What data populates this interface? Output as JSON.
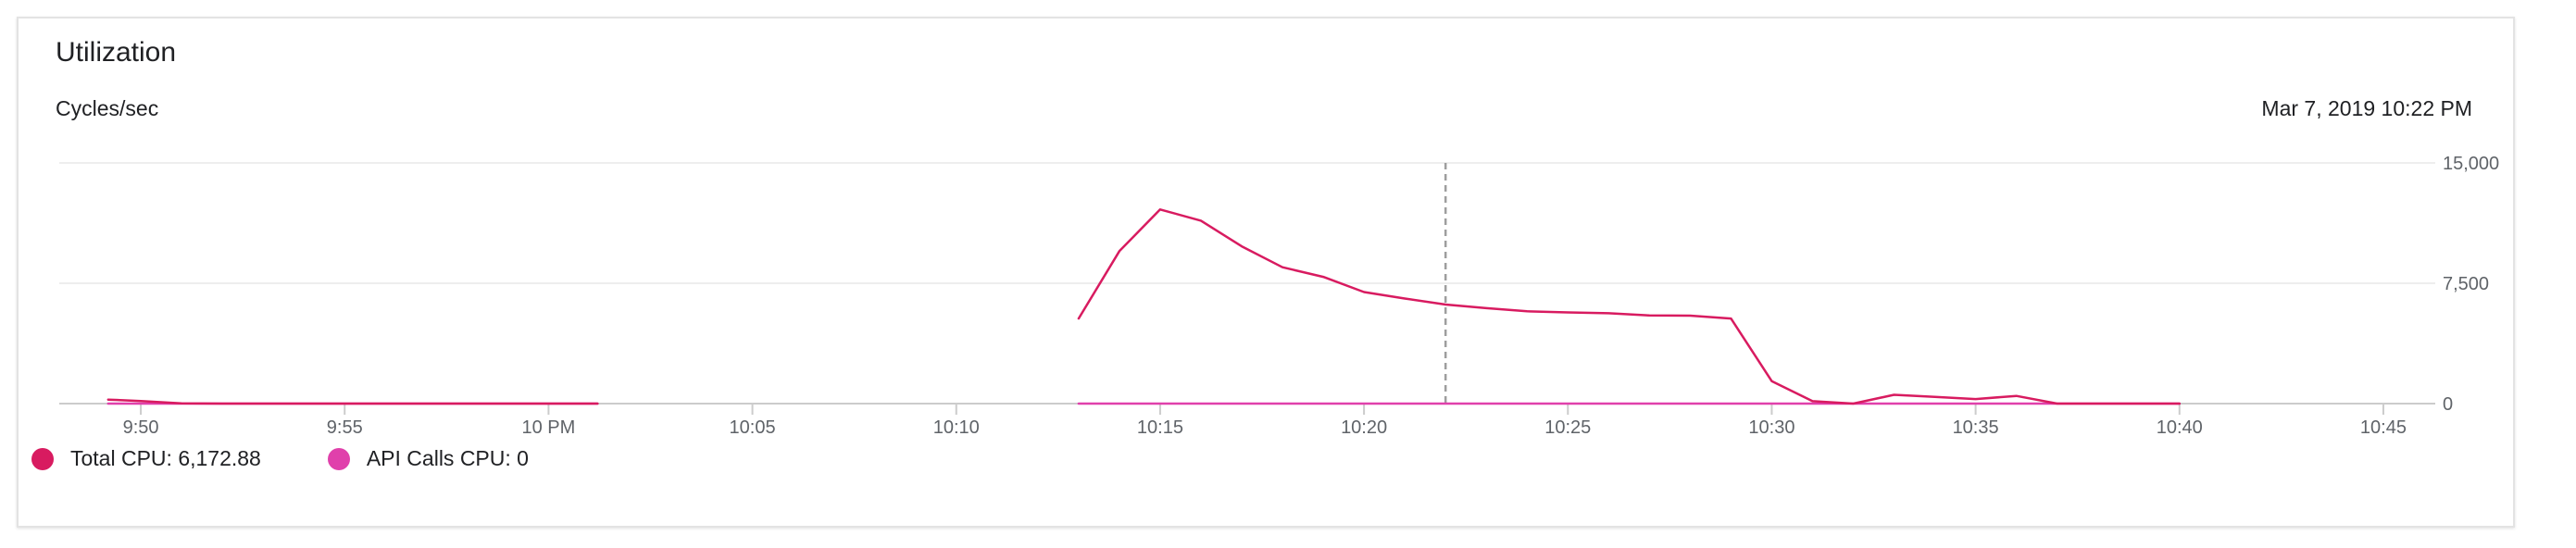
{
  "header": {
    "title": "Utilization",
    "metric": "Cycles/sec",
    "timestamp": "Mar 7, 2019 10:22 PM"
  },
  "colors": {
    "total_cpu": "#d81b60",
    "api_calls_cpu": "#e040ab",
    "grid": "#e8e8e8",
    "axis": "#cccccc",
    "cursor": "#9e9e9e",
    "tick_text": "#5f6368"
  },
  "legend": [
    {
      "label": "Total CPU: 6,172.88",
      "color": "#d81b60"
    },
    {
      "label": "API Calls CPU: 0",
      "color": "#e040ab"
    }
  ],
  "chart_data": {
    "type": "line",
    "x_unit": "minutes after 9:48 PM",
    "xlim": [
      0,
      58.5
    ],
    "ylim": [
      0,
      15000
    ],
    "x_ticks": [
      {
        "value": 2,
        "label": "9:50"
      },
      {
        "value": 7,
        "label": "9:55"
      },
      {
        "value": 12,
        "label": "10 PM"
      },
      {
        "value": 17,
        "label": "10:05"
      },
      {
        "value": 22,
        "label": "10:10"
      },
      {
        "value": 27,
        "label": "10:15"
      },
      {
        "value": 32,
        "label": "10:20"
      },
      {
        "value": 37,
        "label": "10:25"
      },
      {
        "value": 42,
        "label": "10:30"
      },
      {
        "value": 47,
        "label": "10:35"
      },
      {
        "value": 52,
        "label": "10:40"
      },
      {
        "value": 57,
        "label": "10:45"
      }
    ],
    "y_ticks": [
      {
        "value": 0,
        "label": "0"
      },
      {
        "value": 7500,
        "label": "7,500"
      },
      {
        "value": 15000,
        "label": "15,000"
      }
    ],
    "cursor_x": 34,
    "grid": true,
    "legend_position": "bottom-left",
    "series": [
      {
        "name": "Total CPU",
        "color": "#d81b60",
        "segments": [
          [
            [
              1.2,
              250
            ],
            [
              2,
              160
            ],
            [
              3,
              10
            ],
            [
              4,
              0
            ],
            [
              13.2,
              0
            ]
          ],
          [
            [
              25,
              5300
            ],
            [
              26,
              9500
            ],
            [
              27,
              12100
            ],
            [
              28,
              11400
            ],
            [
              29,
              9800
            ],
            [
              30,
              8500
            ],
            [
              31,
              7900
            ],
            [
              32,
              6950
            ],
            [
              33,
              6550
            ],
            [
              34,
              6173
            ],
            [
              35,
              5950
            ],
            [
              36,
              5750
            ],
            [
              37,
              5680
            ],
            [
              38,
              5630
            ],
            [
              39,
              5490
            ],
            [
              40,
              5480
            ],
            [
              41,
              5300
            ],
            [
              42,
              1400
            ],
            [
              43,
              150
            ],
            [
              44,
              0
            ],
            [
              45,
              550
            ],
            [
              46,
              420
            ],
            [
              47,
              280
            ],
            [
              48,
              480
            ],
            [
              49,
              0
            ],
            [
              51,
              0
            ],
            [
              52,
              0
            ]
          ]
        ]
      },
      {
        "name": "API Calls CPU",
        "color": "#e040ab",
        "segments": [
          [
            [
              1.2,
              0
            ],
            [
              13.2,
              0
            ]
          ],
          [
            [
              25,
              0
            ],
            [
              52,
              0
            ]
          ]
        ]
      }
    ]
  }
}
